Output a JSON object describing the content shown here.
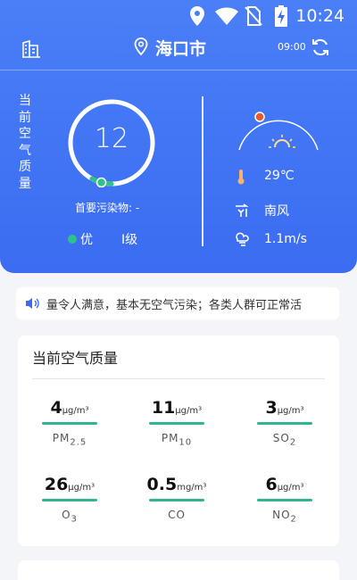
{
  "status_bar": {
    "time": "10:24"
  },
  "header": {
    "city": "海口市",
    "update_time": "09:00"
  },
  "aqi": {
    "vertical_label": "当前空气质量",
    "value": "12",
    "progress_fraction": 0.08,
    "primary_pollutant": "首要污染物: -",
    "level": "优",
    "grade": "I级"
  },
  "weather": {
    "temperature": "29℃",
    "wind": "南风",
    "wind_speed": "1.1m/s"
  },
  "notice": {
    "text": "量令人满意，基本无空气污染；各类人群可正常活"
  },
  "air_quality": {
    "title": "当前空气质量",
    "metrics": [
      {
        "value": "4",
        "unit": "μg/m³",
        "name": "PM",
        "sub": "2.5"
      },
      {
        "value": "11",
        "unit": "μg/m³",
        "name": "PM",
        "sub": "10"
      },
      {
        "value": "3",
        "unit": "μg/m³",
        "name": "SO",
        "sub": "2"
      },
      {
        "value": "26",
        "unit": "μg/m³",
        "name": "O",
        "sub": "3"
      },
      {
        "value": "0.5",
        "unit": "mg/m³",
        "name": "CO",
        "sub": ""
      },
      {
        "value": "6",
        "unit": "μg/m³",
        "name": "NO",
        "sub": "2"
      }
    ]
  },
  "colors": {
    "primary": "#3b6cf2",
    "good": "#2fc18c",
    "bar": "#2fb591",
    "sun": "#e85a2c"
  }
}
